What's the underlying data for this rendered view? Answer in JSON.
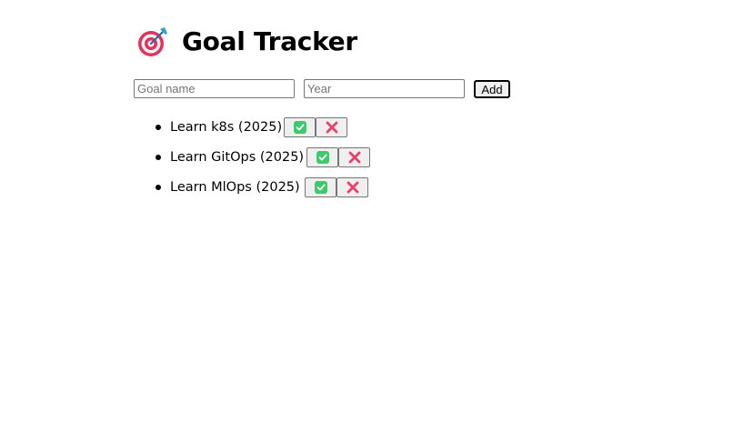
{
  "header": {
    "icon": "target-dart-icon",
    "title": "Goal Tracker"
  },
  "form": {
    "goal_name_placeholder": "Goal name",
    "goal_name_value": "",
    "year_placeholder": "Year",
    "year_value": "",
    "add_label": "Add"
  },
  "goals": [
    {
      "text": "Learn k8s (2025)",
      "complete_icon": "check-box-icon",
      "delete_icon": "cross-mark-icon"
    },
    {
      "text": "Learn GitOps (2025)",
      "complete_icon": "check-box-icon",
      "delete_icon": "cross-mark-icon"
    },
    {
      "text": "Learn MlOps (2025)",
      "complete_icon": "check-box-icon",
      "delete_icon": "cross-mark-icon"
    }
  ],
  "colors": {
    "check_green": "#3ec96e",
    "cross_pink": "#e8416b",
    "target_red": "#e0325c",
    "dart_blue": "#3a9ad9"
  }
}
